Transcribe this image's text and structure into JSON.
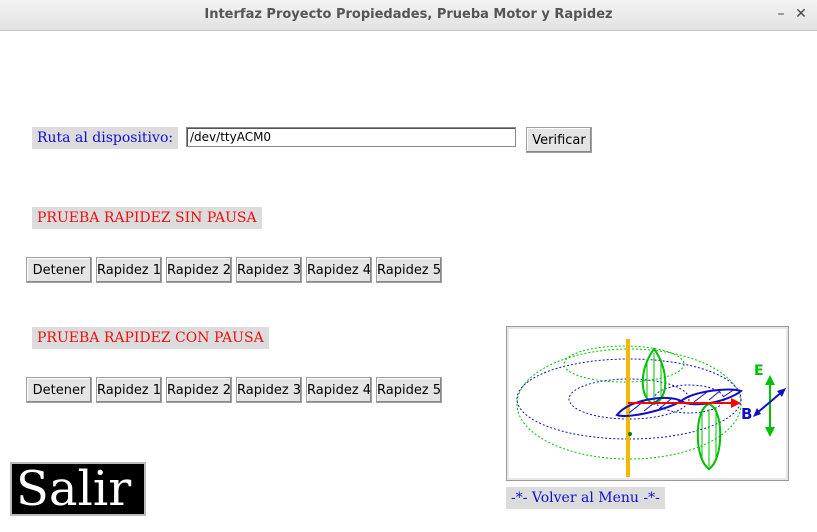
{
  "window": {
    "title": "Interfaz Proyecto Propiedades, Prueba Motor y Rapidez",
    "minimize_glyph": "–",
    "close_glyph": "✕"
  },
  "device": {
    "label": "Ruta al dispositivo:",
    "path_value": "/dev/ttyACM0",
    "verify_label": "Verificar"
  },
  "sin_pausa": {
    "heading": "PRUEBA RAPIDEZ SIN PAUSA",
    "buttons": [
      "Detener",
      "Rapidez 1",
      "Rapidez 2",
      "Rapidez 3",
      "Rapidez 4",
      "Rapidez 5"
    ]
  },
  "con_pausa": {
    "heading": "PRUEBA RAPIDEZ CON PAUSA",
    "buttons": [
      "Detener",
      "Rapidez 1",
      "Rapidez 2",
      "Rapidez 3",
      "Rapidez 4",
      "Rapidez 5"
    ]
  },
  "exit": {
    "label": "Salir"
  },
  "illustration": {
    "e_label": "E",
    "b_label": "B"
  },
  "menu": {
    "back_label": "-*- Volver al Menu -*-"
  }
}
